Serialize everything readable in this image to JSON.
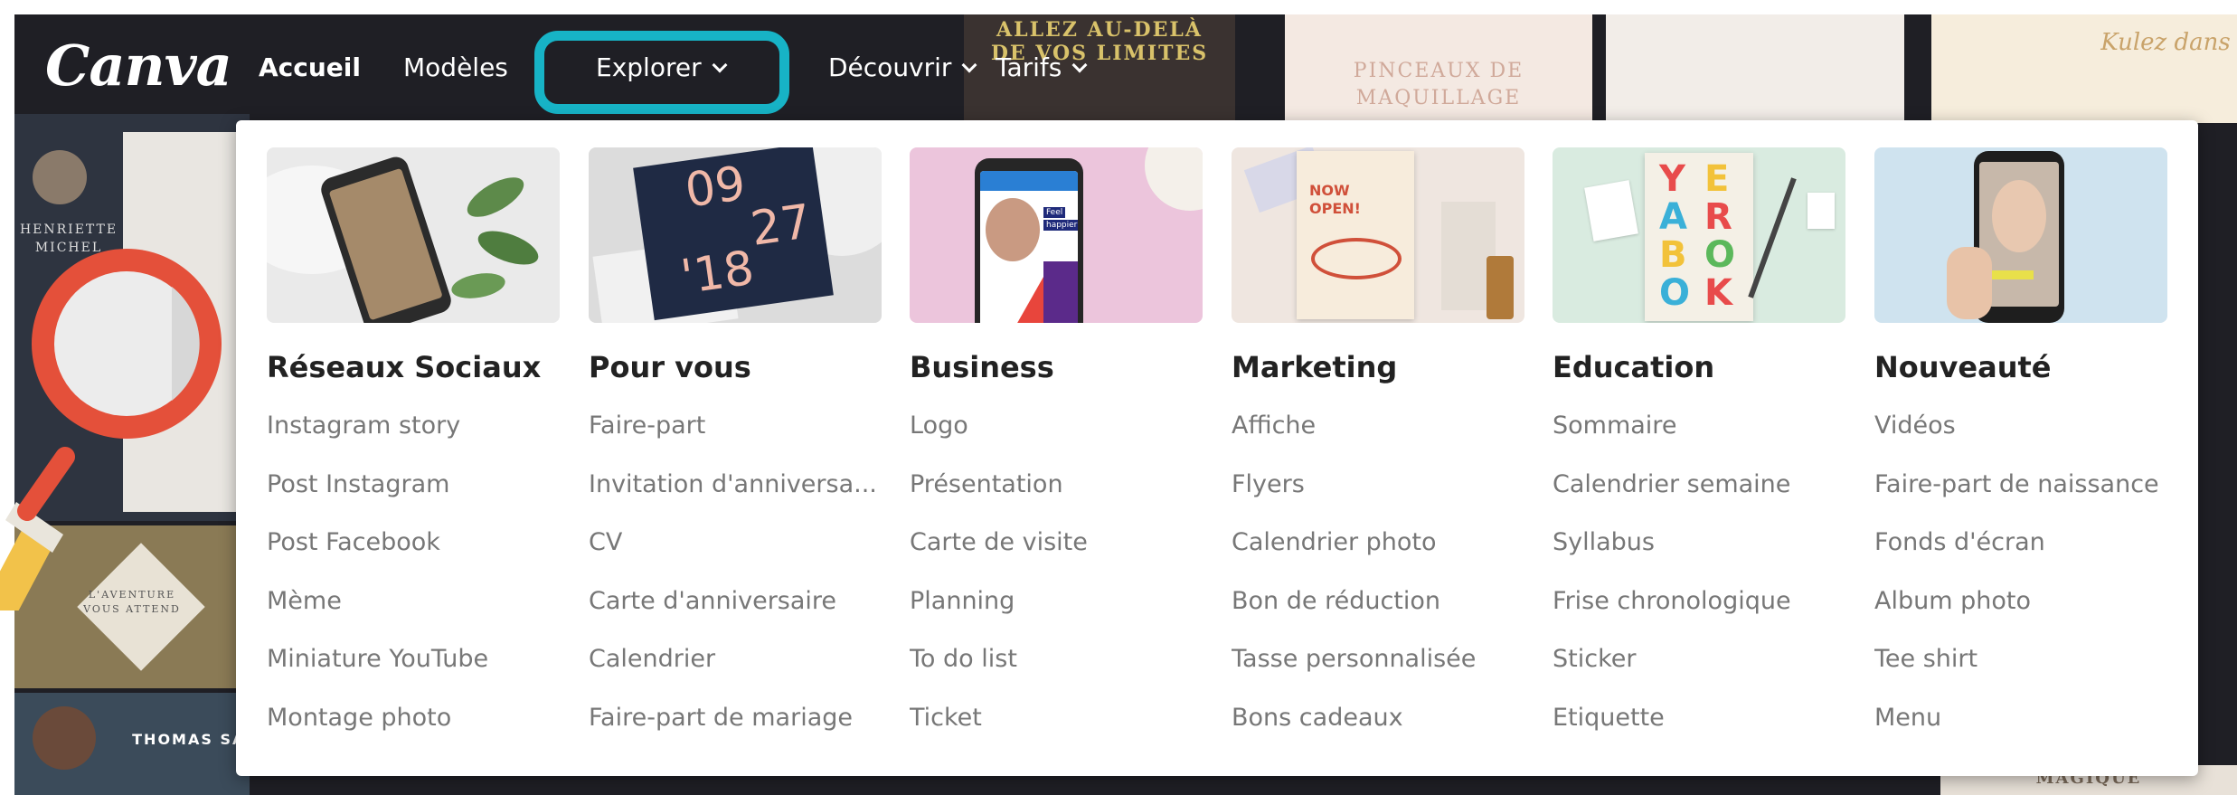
{
  "nav": {
    "logo": "Canva",
    "items": [
      {
        "label": "Accueil"
      },
      {
        "label": "Modèles"
      },
      {
        "label": "Explorer"
      },
      {
        "label": "Découvrir"
      },
      {
        "label": "Tarifs"
      }
    ],
    "highlight_color": "#17b3c6"
  },
  "menu": {
    "columns": [
      {
        "title": "Réseaux Sociaux",
        "items": [
          "Instagram story",
          "Post Instagram",
          "Post Facebook",
          "Mème",
          "Miniature YouTube",
          "Montage photo"
        ]
      },
      {
        "title": "Pour vous",
        "items": [
          "Faire-part",
          "Invitation d'anniversa...",
          "CV",
          "Carte d'anniversaire",
          "Calendrier",
          "Faire-part de mariage"
        ],
        "thumb_text": [
          "09",
          "27",
          "'18"
        ]
      },
      {
        "title": "Business",
        "items": [
          "Logo",
          "Présentation",
          "Carte de visite",
          "Planning",
          "To do list",
          "Ticket"
        ],
        "thumb_text": [
          "Feel",
          "happier"
        ]
      },
      {
        "title": "Marketing",
        "items": [
          "Affiche",
          "Flyers",
          "Calendrier photo",
          "Bon de réduction",
          "Tasse personnalisée",
          "Bons cadeaux"
        ],
        "thumb_text": [
          "NOW",
          "OPEN!"
        ]
      },
      {
        "title": "Education",
        "items": [
          "Sommaire",
          "Calendrier semaine",
          "Syllabus",
          "Frise chronologique",
          "Sticker",
          "Etiquette"
        ],
        "thumb_text": [
          "Y",
          "E",
          "A",
          "R",
          "B",
          "O",
          "O",
          "K"
        ]
      },
      {
        "title": "Nouveauté",
        "items": [
          "Vidéos",
          "Faire-part de naissance",
          "Fonds d'écran",
          "Album photo",
          "Tee shirt",
          "Menu"
        ]
      }
    ]
  },
  "background": {
    "captions": [
      "ALLEZ AU-DELÀ",
      "DE VOS LIMITES",
      "PINCEAUX DE",
      "MAQUILLAGE",
      "Kulez dans",
      "HENRIETTE",
      "MICHEL",
      "L'AVENTURE",
      "VOUS ATTEND",
      "THOMAS SAU",
      "MAGIQUE"
    ]
  },
  "colors": {
    "panel_bg": "#ffffff",
    "title_text": "#222222",
    "item_text": "#777777",
    "magnifier_ring": "#e4503a",
    "magnifier_handle": "#f2c24a"
  }
}
